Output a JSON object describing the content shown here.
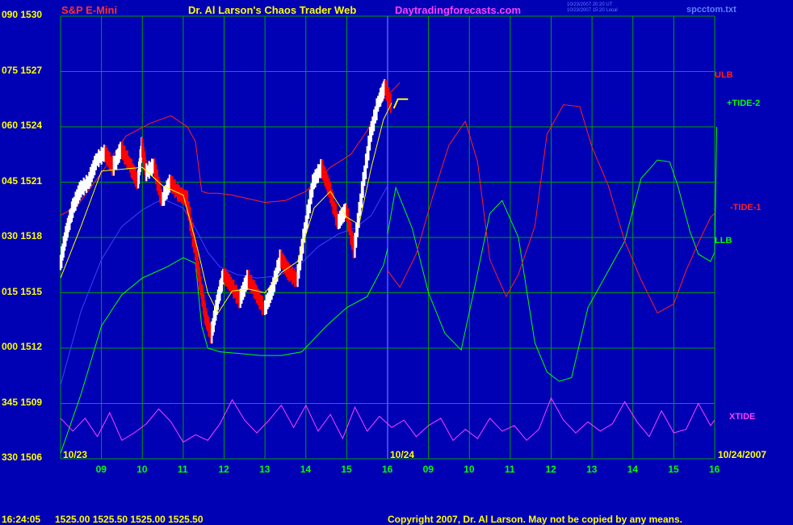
{
  "header": {
    "symbol": "S&P E-Mini",
    "title": "Dr. Al Larson's Chaos Trader Web",
    "site": "Daytradingforecasts.com",
    "stamp_ut": "10/23/2007 20:20 UT",
    "stamp_local": "10/23/2007 15:20 Local",
    "file": "spcctom.txt"
  },
  "footer": {
    "time": "16:24:05",
    "prices": "1525.00  1525.50  1525.00  1525.50",
    "copyright": "Copyright 2007, Dr. Al Larson. May not be copied by any means."
  },
  "colors": {
    "background": "#0000b4",
    "grid": "#00a000",
    "price_up": "#ffffff",
    "price_down": "#ff0000",
    "ulb": "#ff2020",
    "llb": "#00ff00",
    "xtide": "#ff40ff",
    "avg": "#ffff00",
    "slow_avg": "#4040ff"
  },
  "chart_data": {
    "type": "line",
    "ylim": [
      1506,
      1530
    ],
    "xlim": [
      0,
      16
    ],
    "y_ticks": [
      {
        "value": 1530,
        "label": "090 1530"
      },
      {
        "value": 1527,
        "label": "075 1527"
      },
      {
        "value": 1524,
        "label": "060 1524"
      },
      {
        "value": 1521,
        "label": "045 1521"
      },
      {
        "value": 1518,
        "label": "030 1518"
      },
      {
        "value": 1515,
        "label": "015 1515"
      },
      {
        "value": 1512,
        "label": "000 1512"
      },
      {
        "value": 1509,
        "label": "345 1509"
      },
      {
        "value": 1506,
        "label": "330 1506"
      }
    ],
    "x_ticks": [
      {
        "x": 1,
        "label": "09"
      },
      {
        "x": 2,
        "label": "10"
      },
      {
        "x": 3,
        "label": "11"
      },
      {
        "x": 4,
        "label": "12"
      },
      {
        "x": 5,
        "label": "13"
      },
      {
        "x": 6,
        "label": "14"
      },
      {
        "x": 7,
        "label": "15"
      },
      {
        "x": 8,
        "label": "16"
      },
      {
        "x": 9,
        "label": "09"
      },
      {
        "x": 10,
        "label": "10"
      },
      {
        "x": 11,
        "label": "11"
      },
      {
        "x": 12,
        "label": "12"
      },
      {
        "x": 13,
        "label": "13"
      },
      {
        "x": 14,
        "label": "14"
      },
      {
        "x": 15,
        "label": "15"
      },
      {
        "x": 16,
        "label": "16"
      }
    ],
    "day_labels": [
      {
        "x": 0,
        "label": "10/23"
      },
      {
        "x": 8,
        "label": "10/24"
      },
      {
        "x": 16,
        "label": "10/24/2007"
      }
    ],
    "now_x": 8,
    "grid": true,
    "series": [
      {
        "name": "ULB",
        "points": [
          [
            0,
            1519.2
          ],
          [
            0.4,
            1519.7
          ],
          [
            1,
            1521.5
          ],
          [
            1.6,
            1523.5
          ],
          [
            2.2,
            1524.2
          ],
          [
            2.7,
            1524.6
          ],
          [
            3.1,
            1524.0
          ],
          [
            3.3,
            1523.2
          ],
          [
            3.45,
            1520.5
          ],
          [
            3.6,
            1520.4
          ],
          [
            3.85,
            1520.4
          ],
          [
            4.2,
            1520.3
          ],
          [
            4.6,
            1520.1
          ],
          [
            5.0,
            1519.9
          ],
          [
            5.5,
            1520.0
          ],
          [
            6.0,
            1520.5
          ],
          [
            6.6,
            1521.8
          ],
          [
            7.1,
            1522.5
          ],
          [
            7.5,
            1523.8
          ],
          [
            7.9,
            1525.5
          ],
          [
            8.0,
            1525.7
          ],
          [
            8.3,
            1526.4
          ]
        ]
      },
      {
        "name": "LLB",
        "points": [
          [
            0,
            1506.3
          ],
          [
            0.5,
            1509.5
          ],
          [
            1.0,
            1513.2
          ],
          [
            1.5,
            1514.9
          ],
          [
            2.0,
            1515.8
          ],
          [
            2.6,
            1516.4
          ],
          [
            3.0,
            1516.9
          ],
          [
            3.3,
            1516.6
          ],
          [
            3.45,
            1513.2
          ],
          [
            3.6,
            1512.0
          ],
          [
            3.9,
            1511.8
          ],
          [
            4.4,
            1511.7
          ],
          [
            4.9,
            1511.6
          ],
          [
            5.4,
            1511.6
          ],
          [
            5.9,
            1511.8
          ],
          [
            6.5,
            1513.2
          ],
          [
            7.0,
            1514.2
          ],
          [
            7.5,
            1514.8
          ],
          [
            7.9,
            1516.5
          ],
          [
            8.0,
            1517.4
          ]
        ]
      },
      {
        "name": "+TIDE-2",
        "points": [
          [
            8.0,
            1518.2
          ],
          [
            8.2,
            1520.7
          ],
          [
            8.6,
            1518.5
          ],
          [
            9.0,
            1515.0
          ],
          [
            9.4,
            1512.8
          ],
          [
            9.8,
            1511.9
          ],
          [
            10.1,
            1515.0
          ],
          [
            10.5,
            1519.3
          ],
          [
            10.8,
            1520.0
          ],
          [
            11.2,
            1518.0
          ],
          [
            11.6,
            1512.3
          ],
          [
            11.9,
            1510.7
          ],
          [
            12.2,
            1510.2
          ],
          [
            12.5,
            1510.4
          ],
          [
            12.9,
            1514.2
          ],
          [
            13.3,
            1515.8
          ],
          [
            13.8,
            1517.8
          ],
          [
            14.2,
            1521.2
          ],
          [
            14.6,
            1522.2
          ],
          [
            14.9,
            1522.1
          ],
          [
            15.1,
            1520.8
          ],
          [
            15.4,
            1518.3
          ],
          [
            15.6,
            1517.1
          ],
          [
            15.9,
            1516.7
          ],
          [
            16.0,
            1517.2
          ],
          [
            16.05,
            1524.0
          ]
        ]
      },
      {
        "name": "-TIDE-1",
        "points": [
          [
            8.0,
            1516.2
          ],
          [
            8.3,
            1515.3
          ],
          [
            8.7,
            1517.1
          ],
          [
            9.1,
            1520.2
          ],
          [
            9.5,
            1523.0
          ],
          [
            9.9,
            1524.3
          ],
          [
            10.2,
            1522.1
          ],
          [
            10.5,
            1516.8
          ],
          [
            10.9,
            1514.8
          ],
          [
            11.2,
            1516.0
          ],
          [
            11.6,
            1518.6
          ],
          [
            11.9,
            1523.6
          ],
          [
            12.3,
            1525.2
          ],
          [
            12.7,
            1525.1
          ],
          [
            13.0,
            1522.9
          ],
          [
            13.4,
            1520.8
          ],
          [
            13.8,
            1517.8
          ],
          [
            14.2,
            1515.7
          ],
          [
            14.6,
            1513.9
          ],
          [
            15.0,
            1514.4
          ],
          [
            15.3,
            1516.2
          ],
          [
            15.6,
            1517.7
          ],
          [
            15.9,
            1519.1
          ],
          [
            16.0,
            1519.3
          ]
        ]
      },
      {
        "name": "XTIDE",
        "points": [
          [
            0,
            1508.2
          ],
          [
            0.3,
            1507.5
          ],
          [
            0.6,
            1508.2
          ],
          [
            0.9,
            1507.2
          ],
          [
            1.2,
            1508.5
          ],
          [
            1.5,
            1507.0
          ],
          [
            1.8,
            1507.4
          ],
          [
            2.1,
            1507.9
          ],
          [
            2.4,
            1508.7
          ],
          [
            2.7,
            1508.0
          ],
          [
            3.0,
            1506.9
          ],
          [
            3.3,
            1507.3
          ],
          [
            3.6,
            1507.0
          ],
          [
            3.9,
            1507.9
          ],
          [
            4.2,
            1509.2
          ],
          [
            4.5,
            1508.1
          ],
          [
            4.8,
            1507.4
          ],
          [
            5.1,
            1508.1
          ],
          [
            5.4,
            1508.9
          ],
          [
            5.7,
            1507.7
          ],
          [
            6.0,
            1508.9
          ],
          [
            6.3,
            1507.5
          ],
          [
            6.6,
            1508.4
          ],
          [
            6.9,
            1507.1
          ],
          [
            7.2,
            1508.8
          ],
          [
            7.5,
            1507.5
          ],
          [
            7.8,
            1508.3
          ],
          [
            8.1,
            1507.7
          ],
          [
            8.4,
            1508.1
          ],
          [
            8.7,
            1507.2
          ],
          [
            9.0,
            1507.8
          ],
          [
            9.3,
            1508.2
          ],
          [
            9.6,
            1507.0
          ],
          [
            9.9,
            1507.6
          ],
          [
            10.2,
            1507.1
          ],
          [
            10.5,
            1508.2
          ],
          [
            10.8,
            1507.5
          ],
          [
            11.1,
            1507.8
          ],
          [
            11.4,
            1507.0
          ],
          [
            11.7,
            1507.6
          ],
          [
            12.0,
            1509.3
          ],
          [
            12.3,
            1508.1
          ],
          [
            12.6,
            1507.4
          ],
          [
            12.9,
            1508.0
          ],
          [
            13.2,
            1507.5
          ],
          [
            13.5,
            1507.9
          ],
          [
            13.8,
            1509.1
          ],
          [
            14.1,
            1508.0
          ],
          [
            14.4,
            1507.2
          ],
          [
            14.7,
            1508.6
          ],
          [
            15.0,
            1507.4
          ],
          [
            15.3,
            1507.6
          ],
          [
            15.6,
            1509.0
          ],
          [
            15.9,
            1507.8
          ],
          [
            16.0,
            1508.1
          ]
        ]
      },
      {
        "name": "price",
        "points": [
          [
            0,
            1516.5
          ],
          [
            0.15,
            1518.2
          ],
          [
            0.3,
            1519.5
          ],
          [
            0.5,
            1520.6
          ],
          [
            0.7,
            1521.0
          ],
          [
            0.9,
            1522.2
          ],
          [
            1.1,
            1522.6
          ],
          [
            1.3,
            1521.8
          ],
          [
            1.5,
            1522.8
          ],
          [
            1.7,
            1522.0
          ],
          [
            1.9,
            1521.0
          ],
          [
            2.0,
            1523.0
          ],
          [
            2.1,
            1521.5
          ],
          [
            2.3,
            1521.9
          ],
          [
            2.5,
            1520.0
          ],
          [
            2.7,
            1521.0
          ],
          [
            2.9,
            1520.4
          ],
          [
            3.1,
            1520.1
          ],
          [
            3.3,
            1517.5
          ],
          [
            3.45,
            1515.2
          ],
          [
            3.55,
            1513.8
          ],
          [
            3.7,
            1512.7
          ],
          [
            3.85,
            1514.5
          ],
          [
            4.0,
            1516.0
          ],
          [
            4.2,
            1515.4
          ],
          [
            4.4,
            1514.6
          ],
          [
            4.6,
            1515.8
          ],
          [
            4.8,
            1515.0
          ],
          [
            5.0,
            1514.1
          ],
          [
            5.2,
            1515.2
          ],
          [
            5.4,
            1516.9
          ],
          [
            5.6,
            1516.1
          ],
          [
            5.8,
            1515.7
          ],
          [
            6.0,
            1518.5
          ],
          [
            6.2,
            1521.0
          ],
          [
            6.4,
            1521.8
          ],
          [
            6.6,
            1520.6
          ],
          [
            6.8,
            1518.8
          ],
          [
            7.0,
            1519.5
          ],
          [
            7.2,
            1517.3
          ],
          [
            7.4,
            1520.6
          ],
          [
            7.6,
            1523.6
          ],
          [
            7.8,
            1525.4
          ],
          [
            7.95,
            1526.2
          ],
          [
            8.1,
            1525.2
          ]
        ]
      },
      {
        "name": "average",
        "points": [
          [
            0,
            1515.8
          ],
          [
            0.5,
            1518.6
          ],
          [
            1.0,
            1521.6
          ],
          [
            1.5,
            1521.7
          ],
          [
            2.0,
            1521.8
          ],
          [
            2.5,
            1520.8
          ],
          [
            3.0,
            1520.3
          ],
          [
            3.35,
            1517.4
          ],
          [
            3.6,
            1515.0
          ],
          [
            3.85,
            1513.9
          ],
          [
            4.2,
            1515.1
          ],
          [
            4.6,
            1515.2
          ],
          [
            5.0,
            1515.0
          ],
          [
            5.4,
            1516.1
          ],
          [
            5.8,
            1516.7
          ],
          [
            6.2,
            1519.6
          ],
          [
            6.6,
            1520.5
          ],
          [
            7.0,
            1519.1
          ],
          [
            7.3,
            1518.7
          ],
          [
            7.6,
            1521.8
          ],
          [
            7.9,
            1524.4
          ],
          [
            8.1,
            1525.3
          ]
        ]
      },
      {
        "name": "slow-average",
        "points": [
          [
            0,
            1510.0
          ],
          [
            0.5,
            1514.0
          ],
          [
            1.0,
            1516.8
          ],
          [
            1.5,
            1518.6
          ],
          [
            2.0,
            1519.5
          ],
          [
            2.5,
            1520.1
          ],
          [
            3.0,
            1519.6
          ],
          [
            3.3,
            1518.5
          ],
          [
            3.6,
            1517.2
          ],
          [
            3.9,
            1516.4
          ],
          [
            4.3,
            1516.0
          ],
          [
            4.8,
            1515.8
          ],
          [
            5.3,
            1515.9
          ],
          [
            5.8,
            1516.4
          ],
          [
            6.3,
            1517.5
          ],
          [
            6.8,
            1518.2
          ],
          [
            7.2,
            1518.5
          ],
          [
            7.6,
            1519.2
          ],
          [
            8.0,
            1520.8
          ]
        ]
      }
    ],
    "forecast_marker": {
      "points": [
        [
          8.15,
          1525.0
        ],
        [
          8.25,
          1525.5
        ],
        [
          8.5,
          1525.5
        ]
      ]
    }
  },
  "labels": {
    "ulb": "ULB",
    "tide2": "+TIDE-2",
    "tide1": "-TIDE-1",
    "llb": "LLB",
    "xtide": "XTIDE"
  }
}
